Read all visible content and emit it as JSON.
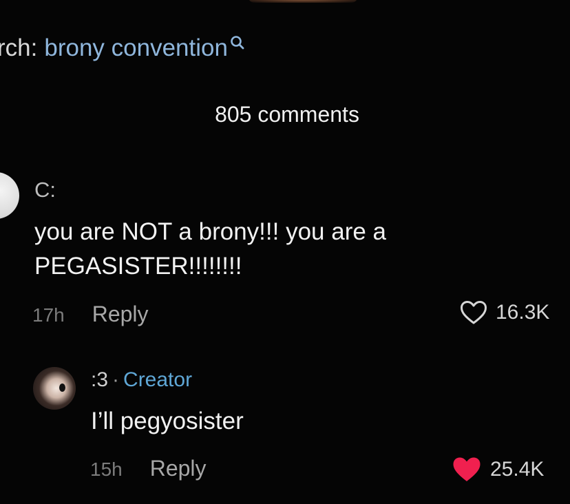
{
  "search": {
    "prefix": "rch:",
    "query": "brony convention",
    "icon": "search-icon"
  },
  "comments_header": {
    "count_label": "805 comments"
  },
  "comments": [
    {
      "username": "C:",
      "text": "you are NOT a brony!!! you are a PEGASISTER!!!!!!!!",
      "time": "17h",
      "reply_label": "Reply",
      "likes": "16.3K",
      "liked": false
    },
    {
      "username": ":3",
      "separator": "·",
      "badge": "Creator",
      "text": "I’ll pegyosister",
      "time": "15h",
      "reply_label": "Reply",
      "likes": "25.4K",
      "liked": true
    }
  ],
  "colors": {
    "background": "#050505",
    "link_blue": "#8fb6dc",
    "creator_blue": "#5fa7d6",
    "liked_red": "#f0204f"
  }
}
